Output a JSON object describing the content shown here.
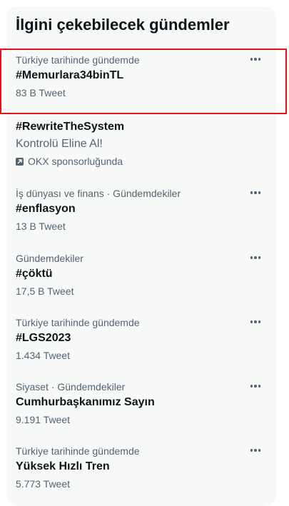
{
  "section_title": "İlgini çekebilecek gündemler",
  "trends": [
    {
      "context": "Türkiye tarihinde gündemde",
      "name": "#Memurlara34binTL",
      "count": "83 B Tweet"
    },
    {
      "context": "İş dünyası ve finans · Gündemdekiler",
      "name": "#enflasyon",
      "count": "13 B Tweet"
    },
    {
      "context": "Gündemdekiler",
      "name": "#çöktü",
      "count": "17,5 B Tweet"
    },
    {
      "context": "Türkiye tarihinde gündemde",
      "name": "#LGS2023",
      "count": "1.434 Tweet"
    },
    {
      "context": "Siyaset · Gündemdekiler",
      "name": "Cumhurbaşkanımız Sayın",
      "count": "9.191 Tweet"
    },
    {
      "context": "Türkiye tarihinde gündemde",
      "name": "Yüksek Hızlı Tren",
      "count": "5.773 Tweet"
    }
  ],
  "promoted": {
    "name": "#RewriteTheSystem",
    "description": "Kontrolü Eline Al!",
    "sponsor": "OKX sponsorluğunda",
    "icon": "promoted-icon"
  },
  "more_icon": "more-options-icon",
  "colors": {
    "text_primary": "#0f1419",
    "text_secondary": "#536471",
    "panel_bg": "#f7f9f9",
    "highlight_border": "#e0131e"
  }
}
